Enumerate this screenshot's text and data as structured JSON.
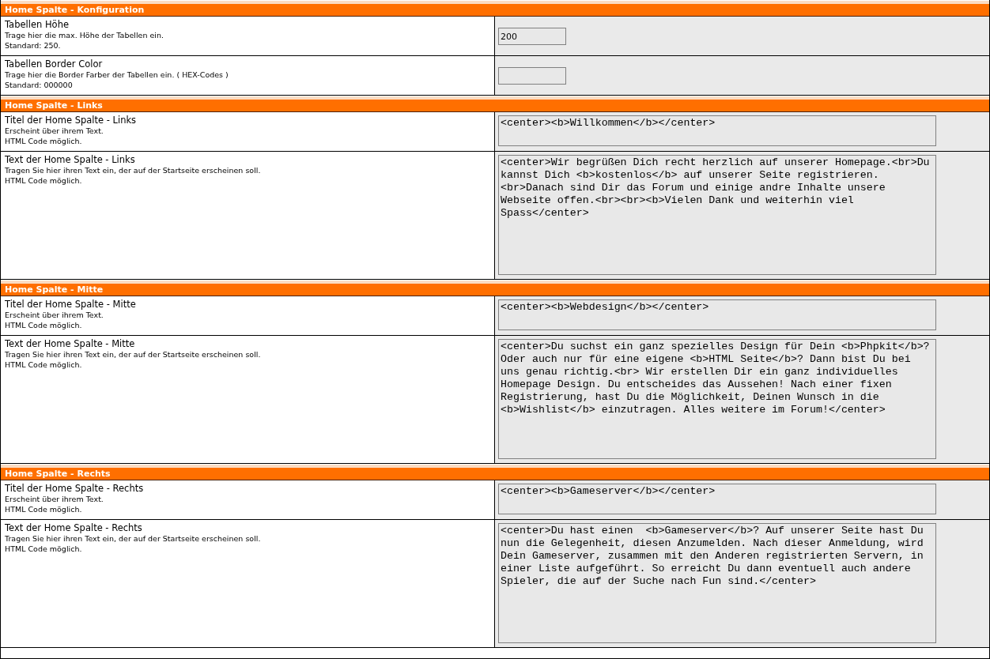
{
  "sections": [
    {
      "title": "Home Spalte - Konfiguration",
      "rows": [
        {
          "label": "Tabellen Höhe",
          "hints": [
            "Trage hier die max. Höhe der Tabellen ein.",
            "Standard: 250."
          ],
          "field": {
            "kind": "input",
            "value": "200"
          }
        },
        {
          "label": "Tabellen Border Color",
          "hints": [
            "Trage hier die Border Farber der Tabellen ein. ( HEX-Codes )",
            "Standard: 000000"
          ],
          "field": {
            "kind": "input"
          }
        }
      ]
    },
    {
      "title": "Home Spalte - Links",
      "rows": [
        {
          "label": "Titel der Home Spalte - Links",
          "hints": [
            "Erscheint über ihrem Text.",
            "HTML Code möglich."
          ],
          "field": {
            "kind": "short-area",
            "value": "<center><b>Willkommen</b></center>"
          }
        },
        {
          "label": "Text der Home Spalte - Links",
          "hints": [
            "Tragen Sie hier ihren Text ein, der auf der Startseite erscheinen soll.",
            "HTML Code möglich."
          ],
          "field": {
            "kind": "long-area",
            "value": "<center>Wir begrüßen Dich recht herzlich auf unserer Homepage.<br>Du kannst Dich <b>kostenlos</b> auf unserer Seite registrieren.<br>Danach sind Dir das Forum und einige andre Inhalte unsere Webseite offen.<br><br><b>Vielen Dank und weiterhin viel Spass</center>"
          }
        }
      ]
    },
    {
      "title": "Home Spalte - Mitte",
      "rows": [
        {
          "label": "Titel der Home Spalte - Mitte",
          "hints": [
            "Erscheint über ihrem Text.",
            "HTML Code möglich."
          ],
          "field": {
            "kind": "short-area",
            "value": "<center><b>Webdesign</b></center>"
          }
        },
        {
          "label": "Text der Home Spalte - Mitte",
          "hints": [
            "Tragen Sie hier ihren Text ein, der auf der Startseite erscheinen soll.",
            "HTML Code möglich."
          ],
          "field": {
            "kind": "long-area",
            "value": "<center>Du suchst ein ganz spezielles Design für Dein <b>Phpkit</b>? Oder auch nur für eine eigene <b>HTML Seite</b>? Dann bist Du bei uns genau richtig.<br> Wir erstellen Dir ein ganz individuelles Homepage Design. Du entscheides das Aussehen! Nach einer fixen Registrierung, hast Du die Möglichkeit, Deinen Wunsch in die <b>Wishlist</b> einzutragen. Alles weitere im Forum!</center>"
          }
        }
      ]
    },
    {
      "title": "Home Spalte - Rechts",
      "rows": [
        {
          "label": "Titel der Home Spalte - Rechts",
          "hints": [
            "Erscheint über ihrem Text.",
            "HTML Code möglich."
          ],
          "field": {
            "kind": "short-area",
            "value": "<center><b>Gameserver</b></center>"
          }
        },
        {
          "label": "Text der Home Spalte - Rechts",
          "hints": [
            "Tragen Sie hier ihren Text ein, der auf der Startseite erscheinen soll.",
            "HTML Code möglich."
          ],
          "field": {
            "kind": "long-area",
            "value": "<center>Du hast einen  <b>Gameserver</b>? Auf unserer Seite hast Du nun die Gelegenheit, diesen Anzumelden. Nach dieser Anmeldung, wird Dein Gameserver, zusammen mit den Anderen registrierten Servern, in einer Liste aufgeführt. So erreicht Du dann eventuell auch andere Spieler, die auf der Suche nach Fun sind.</center>"
          }
        }
      ]
    }
  ]
}
